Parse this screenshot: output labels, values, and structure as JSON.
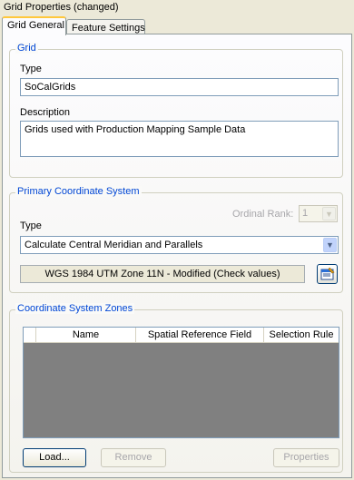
{
  "window": {
    "title": "Grid Properties (changed)"
  },
  "tabs": [
    {
      "label": "Grid General",
      "active": true
    },
    {
      "label": "Feature Settings",
      "active": false
    }
  ],
  "grid_group": {
    "legend": "Grid",
    "type_label": "Type",
    "type_value": "SoCalGrids",
    "description_label": "Description",
    "description_value": "Grids used with Production Mapping Sample Data"
  },
  "pcs_group": {
    "legend": "Primary Coordinate System",
    "ordinal_rank_label": "Ordinal Rank:",
    "ordinal_rank_value": "1",
    "type_label": "Type",
    "type_value": "Calculate Central Meridian and Parallels",
    "coordinate_system": "WGS 1984 UTM Zone 11N - Modified (Check values)",
    "properties_icon": "properties-icon"
  },
  "zones_group": {
    "legend": "Coordinate System Zones",
    "columns": [
      "Name",
      "Spatial Reference Field",
      "Selection Rule"
    ],
    "rows": [],
    "load_label": "Load...",
    "remove_label": "Remove",
    "properties_label": "Properties"
  },
  "colors": {
    "window_bg": "#ece9d8",
    "legend": "#0046d5",
    "tab_highlight": "#ffc83c",
    "table_bg": "#808080"
  }
}
